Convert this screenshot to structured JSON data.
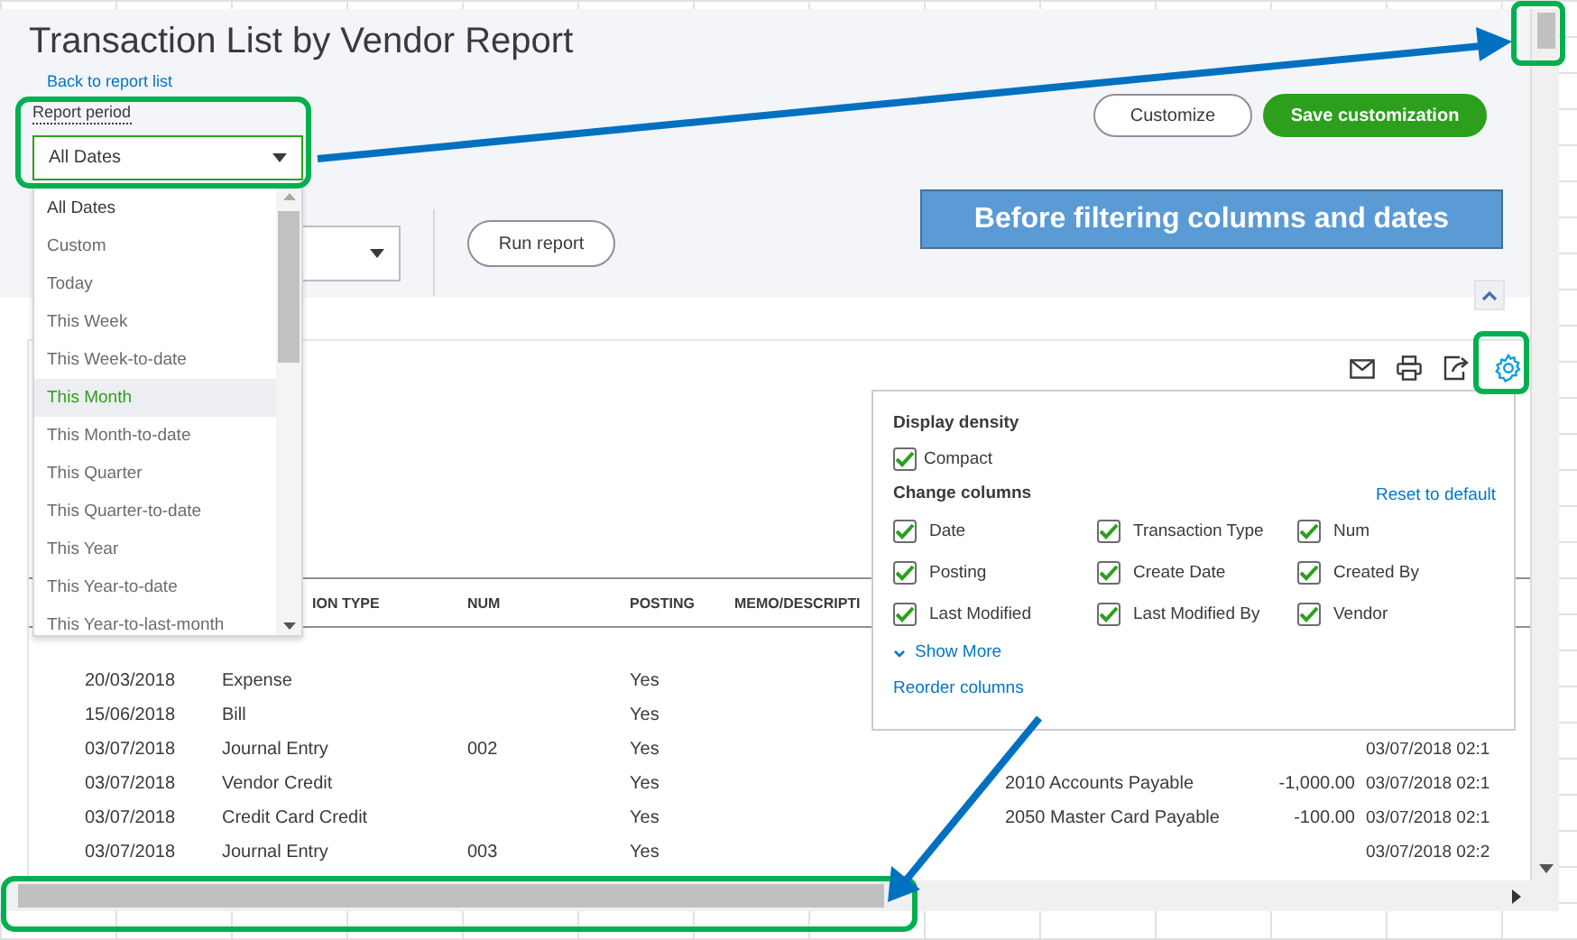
{
  "window": {
    "title": "Transaction List by Vendor Report"
  },
  "back_link": "Back to report list",
  "report_period": {
    "label": "Report period",
    "value": "All Dates",
    "options": [
      {
        "label": "All Dates",
        "selected": true,
        "highlighted": false
      },
      {
        "label": "Custom",
        "selected": false,
        "highlighted": false
      },
      {
        "label": "Today",
        "selected": false,
        "highlighted": false
      },
      {
        "label": "This Week",
        "selected": false,
        "highlighted": false
      },
      {
        "label": "This Week-to-date",
        "selected": false,
        "highlighted": false
      },
      {
        "label": "This Month",
        "selected": false,
        "highlighted": true
      },
      {
        "label": "This Month-to-date",
        "selected": false,
        "highlighted": false
      },
      {
        "label": "This Quarter",
        "selected": false,
        "highlighted": false
      },
      {
        "label": "This Quarter-to-date",
        "selected": false,
        "highlighted": false
      },
      {
        "label": "This Year",
        "selected": false,
        "highlighted": false
      },
      {
        "label": "This Year-to-date",
        "selected": false,
        "highlighted": false
      },
      {
        "label": "This Year-to-last-month",
        "selected": false,
        "highlighted": false
      }
    ]
  },
  "actions": [
    {
      "label": "Customize",
      "kind": "secondary"
    },
    {
      "label": "Save customization",
      "kind": "primary"
    }
  ],
  "run_report": "Run report",
  "callout": "Before filtering columns and dates",
  "table": {
    "columns": [
      "ION TYPE",
      "NUM",
      "POSTING",
      "MEMO/DESCRIPTI"
    ],
    "rows": [
      {
        "date": "20/03/2018",
        "type": "Expense",
        "posting": "Yes"
      },
      {
        "date": "15/06/2018",
        "type": "Bill",
        "posting": "Yes"
      },
      {
        "date": "03/07/2018",
        "type": "Journal Entry",
        "num": "002",
        "posting": "Yes",
        "created": "03/07/2018 02:1"
      },
      {
        "date": "03/07/2018",
        "type": "Vendor Credit",
        "posting": "Yes",
        "account": "2010 Accounts Payable",
        "amount": "-1,000.00",
        "created": "03/07/2018 02:1"
      },
      {
        "date": "03/07/2018",
        "type": "Credit Card Credit",
        "posting": "Yes",
        "account": "2050 Master Card Payable",
        "amount": "-100.00",
        "created": "03/07/2018 02:1"
      },
      {
        "date": "03/07/2018",
        "type": "Journal Entry",
        "num": "003",
        "posting": "Yes",
        "created": "03/07/2018 02:2"
      }
    ]
  },
  "settings": {
    "density_title": "Display density",
    "density": [
      {
        "label": "Compact",
        "checked": true
      }
    ],
    "columns_title": "Change columns",
    "reset": "Reset to default",
    "columns": [
      {
        "label": "Date",
        "checked": true
      },
      {
        "label": "Transaction Type",
        "checked": true
      },
      {
        "label": "Num",
        "checked": true
      },
      {
        "label": "Posting",
        "checked": true
      },
      {
        "label": "Create Date",
        "checked": true
      },
      {
        "label": "Created By",
        "checked": true
      },
      {
        "label": "Last Modified",
        "checked": true
      },
      {
        "label": "Last Modified By",
        "checked": true
      },
      {
        "label": "Vendor",
        "checked": true
      }
    ],
    "show_more": "Show More",
    "reorder": "Reorder columns"
  }
}
